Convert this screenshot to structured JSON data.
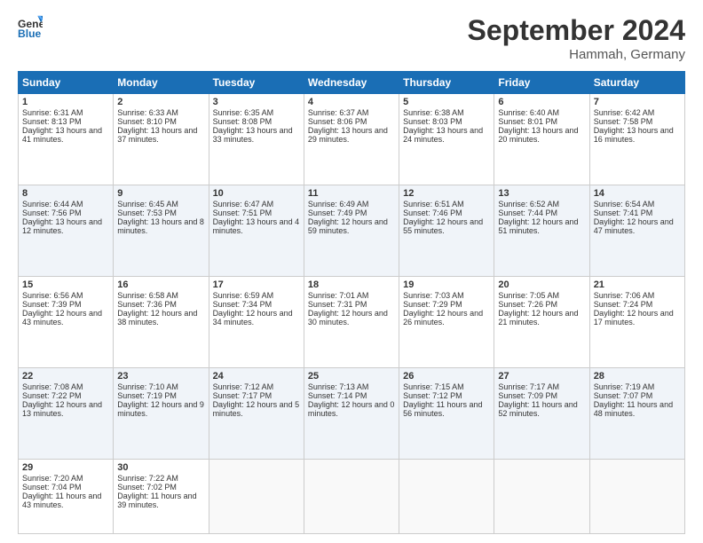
{
  "logo": {
    "line1": "General",
    "line2": "Blue"
  },
  "title": "September 2024",
  "location": "Hammah, Germany",
  "days_header": [
    "Sunday",
    "Monday",
    "Tuesday",
    "Wednesday",
    "Thursday",
    "Friday",
    "Saturday"
  ],
  "weeks": [
    [
      {
        "day": "1",
        "sunrise": "Sunrise: 6:31 AM",
        "sunset": "Sunset: 8:13 PM",
        "daylight": "Daylight: 13 hours and 41 minutes."
      },
      {
        "day": "2",
        "sunrise": "Sunrise: 6:33 AM",
        "sunset": "Sunset: 8:10 PM",
        "daylight": "Daylight: 13 hours and 37 minutes."
      },
      {
        "day": "3",
        "sunrise": "Sunrise: 6:35 AM",
        "sunset": "Sunset: 8:08 PM",
        "daylight": "Daylight: 13 hours and 33 minutes."
      },
      {
        "day": "4",
        "sunrise": "Sunrise: 6:37 AM",
        "sunset": "Sunset: 8:06 PM",
        "daylight": "Daylight: 13 hours and 29 minutes."
      },
      {
        "day": "5",
        "sunrise": "Sunrise: 6:38 AM",
        "sunset": "Sunset: 8:03 PM",
        "daylight": "Daylight: 13 hours and 24 minutes."
      },
      {
        "day": "6",
        "sunrise": "Sunrise: 6:40 AM",
        "sunset": "Sunset: 8:01 PM",
        "daylight": "Daylight: 13 hours and 20 minutes."
      },
      {
        "day": "7",
        "sunrise": "Sunrise: 6:42 AM",
        "sunset": "Sunset: 7:58 PM",
        "daylight": "Daylight: 13 hours and 16 minutes."
      }
    ],
    [
      {
        "day": "8",
        "sunrise": "Sunrise: 6:44 AM",
        "sunset": "Sunset: 7:56 PM",
        "daylight": "Daylight: 13 hours and 12 minutes."
      },
      {
        "day": "9",
        "sunrise": "Sunrise: 6:45 AM",
        "sunset": "Sunset: 7:53 PM",
        "daylight": "Daylight: 13 hours and 8 minutes."
      },
      {
        "day": "10",
        "sunrise": "Sunrise: 6:47 AM",
        "sunset": "Sunset: 7:51 PM",
        "daylight": "Daylight: 13 hours and 4 minutes."
      },
      {
        "day": "11",
        "sunrise": "Sunrise: 6:49 AM",
        "sunset": "Sunset: 7:49 PM",
        "daylight": "Daylight: 12 hours and 59 minutes."
      },
      {
        "day": "12",
        "sunrise": "Sunrise: 6:51 AM",
        "sunset": "Sunset: 7:46 PM",
        "daylight": "Daylight: 12 hours and 55 minutes."
      },
      {
        "day": "13",
        "sunrise": "Sunrise: 6:52 AM",
        "sunset": "Sunset: 7:44 PM",
        "daylight": "Daylight: 12 hours and 51 minutes."
      },
      {
        "day": "14",
        "sunrise": "Sunrise: 6:54 AM",
        "sunset": "Sunset: 7:41 PM",
        "daylight": "Daylight: 12 hours and 47 minutes."
      }
    ],
    [
      {
        "day": "15",
        "sunrise": "Sunrise: 6:56 AM",
        "sunset": "Sunset: 7:39 PM",
        "daylight": "Daylight: 12 hours and 43 minutes."
      },
      {
        "day": "16",
        "sunrise": "Sunrise: 6:58 AM",
        "sunset": "Sunset: 7:36 PM",
        "daylight": "Daylight: 12 hours and 38 minutes."
      },
      {
        "day": "17",
        "sunrise": "Sunrise: 6:59 AM",
        "sunset": "Sunset: 7:34 PM",
        "daylight": "Daylight: 12 hours and 34 minutes."
      },
      {
        "day": "18",
        "sunrise": "Sunrise: 7:01 AM",
        "sunset": "Sunset: 7:31 PM",
        "daylight": "Daylight: 12 hours and 30 minutes."
      },
      {
        "day": "19",
        "sunrise": "Sunrise: 7:03 AM",
        "sunset": "Sunset: 7:29 PM",
        "daylight": "Daylight: 12 hours and 26 minutes."
      },
      {
        "day": "20",
        "sunrise": "Sunrise: 7:05 AM",
        "sunset": "Sunset: 7:26 PM",
        "daylight": "Daylight: 12 hours and 21 minutes."
      },
      {
        "day": "21",
        "sunrise": "Sunrise: 7:06 AM",
        "sunset": "Sunset: 7:24 PM",
        "daylight": "Daylight: 12 hours and 17 minutes."
      }
    ],
    [
      {
        "day": "22",
        "sunrise": "Sunrise: 7:08 AM",
        "sunset": "Sunset: 7:22 PM",
        "daylight": "Daylight: 12 hours and 13 minutes."
      },
      {
        "day": "23",
        "sunrise": "Sunrise: 7:10 AM",
        "sunset": "Sunset: 7:19 PM",
        "daylight": "Daylight: 12 hours and 9 minutes."
      },
      {
        "day": "24",
        "sunrise": "Sunrise: 7:12 AM",
        "sunset": "Sunset: 7:17 PM",
        "daylight": "Daylight: 12 hours and 5 minutes."
      },
      {
        "day": "25",
        "sunrise": "Sunrise: 7:13 AM",
        "sunset": "Sunset: 7:14 PM",
        "daylight": "Daylight: 12 hours and 0 minutes."
      },
      {
        "day": "26",
        "sunrise": "Sunrise: 7:15 AM",
        "sunset": "Sunset: 7:12 PM",
        "daylight": "Daylight: 11 hours and 56 minutes."
      },
      {
        "day": "27",
        "sunrise": "Sunrise: 7:17 AM",
        "sunset": "Sunset: 7:09 PM",
        "daylight": "Daylight: 11 hours and 52 minutes."
      },
      {
        "day": "28",
        "sunrise": "Sunrise: 7:19 AM",
        "sunset": "Sunset: 7:07 PM",
        "daylight": "Daylight: 11 hours and 48 minutes."
      }
    ],
    [
      {
        "day": "29",
        "sunrise": "Sunrise: 7:20 AM",
        "sunset": "Sunset: 7:04 PM",
        "daylight": "Daylight: 11 hours and 43 minutes."
      },
      {
        "day": "30",
        "sunrise": "Sunrise: 7:22 AM",
        "sunset": "Sunset: 7:02 PM",
        "daylight": "Daylight: 11 hours and 39 minutes."
      },
      null,
      null,
      null,
      null,
      null
    ]
  ]
}
